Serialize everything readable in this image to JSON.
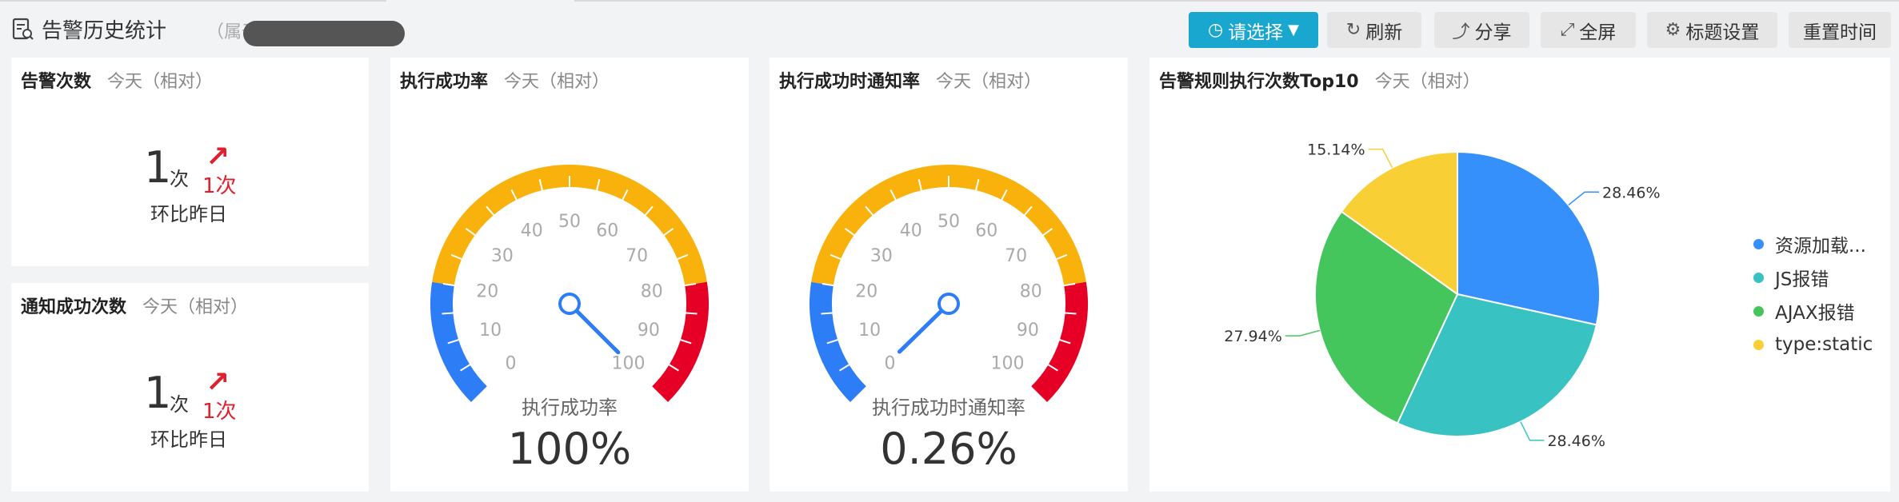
{
  "header": {
    "title": "告警历史统计",
    "belong": "（属于",
    "buttons": {
      "select": "请选择",
      "refresh": "刷新",
      "share": "分享",
      "fullscreen": "全屏",
      "title_settings": "标题设置",
      "reset_time": "重置时间"
    }
  },
  "cards": {
    "alert_count": {
      "title": "告警次数",
      "range": "今天（相对）",
      "value": "1",
      "unit": "次",
      "change": "1次",
      "compare": "环比昨日"
    },
    "notify_count": {
      "title": "通知成功次数",
      "range": "今天（相对）",
      "value": "1",
      "unit": "次",
      "change": "1次",
      "compare": "环比昨日"
    },
    "success_rate": {
      "title": "执行成功率",
      "range": "今天（相对）",
      "label": "执行成功率",
      "value_text": "100%",
      "value": 100
    },
    "notify_rate": {
      "title": "执行成功时通知率",
      "range": "今天（相对）",
      "label": "执行成功时通知率",
      "value_text": "0.26%",
      "value": 0.26
    },
    "top10": {
      "title": "告警规则执行次数Top10",
      "range": "今天（相对）"
    }
  },
  "gauge": {
    "ticks": [
      "0",
      "10",
      "20",
      "30",
      "40",
      "50",
      "60",
      "70",
      "80",
      "90",
      "100"
    ],
    "colors": {
      "low": "#2d7df6",
      "mid": "#f9b10b",
      "high": "#e60026"
    }
  },
  "chart_data": {
    "type": "pie",
    "labels": [
      "资源加载...",
      "JS报错",
      "AJAX报错",
      "type:static"
    ],
    "values": [
      28.46,
      28.46,
      27.94,
      15.14
    ],
    "value_labels": [
      "28.46%",
      "28.46%",
      "27.94%",
      "15.14%"
    ],
    "colors": [
      "#3590fb",
      "#38c2c2",
      "#45c65c",
      "#f9cf36"
    ],
    "legend_position": "right"
  }
}
